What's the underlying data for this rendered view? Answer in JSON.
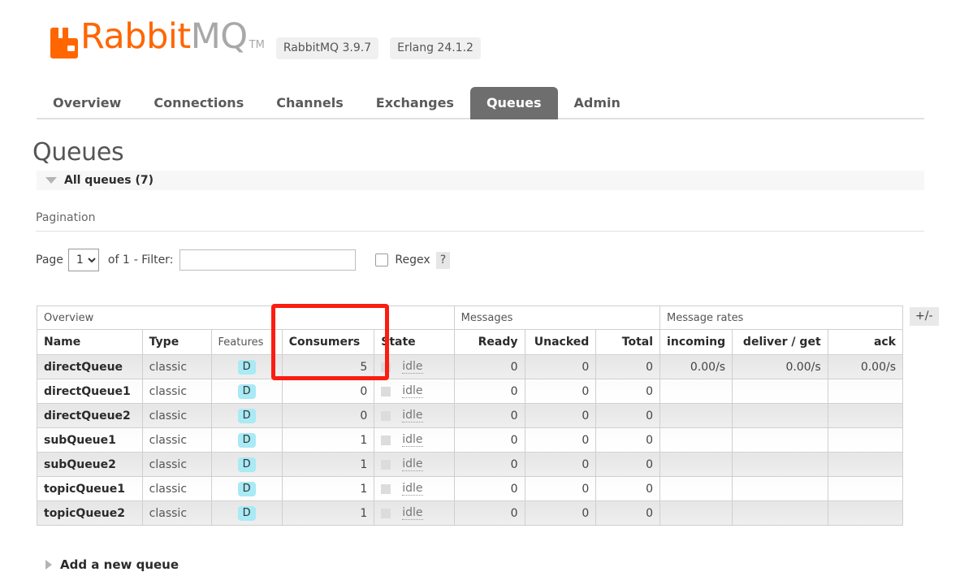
{
  "header": {
    "logo_rabbit": "Rabbit",
    "logo_mq": "MQ",
    "logo_tm": "TM",
    "rabbitmq_version": "RabbitMQ 3.9.7",
    "erlang_version": "Erlang 24.1.2",
    "brand_color": "#ff6600"
  },
  "nav": {
    "tabs": [
      {
        "label": "Overview",
        "active": false
      },
      {
        "label": "Connections",
        "active": false
      },
      {
        "label": "Channels",
        "active": false
      },
      {
        "label": "Exchanges",
        "active": false
      },
      {
        "label": "Queues",
        "active": true
      },
      {
        "label": "Admin",
        "active": false
      }
    ],
    "active_tab_bg": "#6e6e6e"
  },
  "page": {
    "title": "Queues",
    "all_queues_label": "All queues (7)",
    "queue_count": 7,
    "add_queue_label": "Add a new queue"
  },
  "pagination": {
    "section_label": "Pagination",
    "page_label": "Page",
    "page_value": "1",
    "page_options": [
      "1"
    ],
    "of_label": "of 1",
    "filter_label": "- Filter:",
    "filter_value": "",
    "filter_placeholder": "",
    "regex_label": "Regex",
    "regex_checked": false,
    "help_label": "?"
  },
  "table": {
    "group_headers": [
      {
        "label": "Overview",
        "span": 5
      },
      {
        "label": "Messages",
        "span": 3
      },
      {
        "label": "Message rates",
        "span": 3
      }
    ],
    "columns": [
      {
        "label": "Name",
        "sortable": true,
        "align": "left"
      },
      {
        "label": "Type",
        "sortable": true,
        "align": "left"
      },
      {
        "label": "Features",
        "sortable": false,
        "align": "left"
      },
      {
        "label": "Consumers",
        "sortable": true,
        "align": "left"
      },
      {
        "label": "State",
        "sortable": true,
        "align": "left"
      },
      {
        "label": "Ready",
        "sortable": true,
        "align": "right"
      },
      {
        "label": "Unacked",
        "sortable": true,
        "align": "right"
      },
      {
        "label": "Total",
        "sortable": true,
        "align": "right"
      },
      {
        "label": "incoming",
        "sortable": true,
        "align": "right"
      },
      {
        "label": "deliver / get",
        "sortable": true,
        "align": "right"
      },
      {
        "label": "ack",
        "sortable": true,
        "align": "right"
      }
    ],
    "toggle_columns_label": "+/-",
    "rows": [
      {
        "name": "directQueue",
        "type": "classic",
        "feature": "D",
        "consumers": "5",
        "state": "idle",
        "ready": "0",
        "unacked": "0",
        "total": "0",
        "incoming": "0.00/s",
        "deliver_get": "0.00/s",
        "ack": "0.00/s"
      },
      {
        "name": "directQueue1",
        "type": "classic",
        "feature": "D",
        "consumers": "0",
        "state": "idle",
        "ready": "0",
        "unacked": "0",
        "total": "0",
        "incoming": "",
        "deliver_get": "",
        "ack": ""
      },
      {
        "name": "directQueue2",
        "type": "classic",
        "feature": "D",
        "consumers": "0",
        "state": "idle",
        "ready": "0",
        "unacked": "0",
        "total": "0",
        "incoming": "",
        "deliver_get": "",
        "ack": ""
      },
      {
        "name": "subQueue1",
        "type": "classic",
        "feature": "D",
        "consumers": "1",
        "state": "idle",
        "ready": "0",
        "unacked": "0",
        "total": "0",
        "incoming": "",
        "deliver_get": "",
        "ack": ""
      },
      {
        "name": "subQueue2",
        "type": "classic",
        "feature": "D",
        "consumers": "1",
        "state": "idle",
        "ready": "0",
        "unacked": "0",
        "total": "0",
        "incoming": "",
        "deliver_get": "",
        "ack": ""
      },
      {
        "name": "topicQueue1",
        "type": "classic",
        "feature": "D",
        "consumers": "1",
        "state": "idle",
        "ready": "0",
        "unacked": "0",
        "total": "0",
        "incoming": "",
        "deliver_get": "",
        "ack": ""
      },
      {
        "name": "topicQueue2",
        "type": "classic",
        "feature": "D",
        "consumers": "1",
        "state": "idle",
        "ready": "0",
        "unacked": "0",
        "total": "0",
        "incoming": "",
        "deliver_get": "",
        "ack": ""
      }
    ]
  },
  "annotation": {
    "color": "#fc1c10",
    "highlights_column": "Consumers"
  }
}
